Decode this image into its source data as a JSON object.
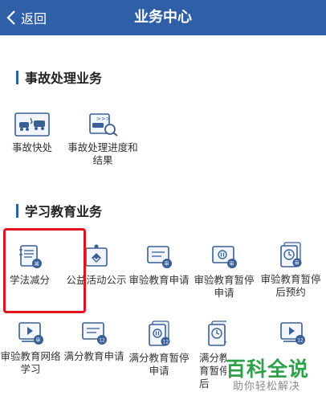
{
  "header": {
    "back_label": "返回",
    "title": "业务中心",
    "bg_color": "#2f5fa6"
  },
  "accident": {
    "title": "事故处理业务",
    "items": [
      {
        "label": "事故快处",
        "icon": "accident-quick-icon"
      },
      {
        "label": "事故处理进度和结果",
        "icon": "accident-progress-icon"
      }
    ]
  },
  "study": {
    "title": "学习教育业务",
    "items": [
      {
        "label": "学法减分",
        "icon": "study-law-icon"
      },
      {
        "label": "公益活动公示",
        "icon": "public-welfare-icon"
      },
      {
        "label": "审验教育申请",
        "icon": "review-education-apply-icon"
      },
      {
        "label": "审验教育暂停申请",
        "icon": "review-education-pause-icon"
      },
      {
        "label": "审验教育暂停后预约",
        "icon": "review-education-appointment-icon"
      },
      {
        "label": "审验教育网络学习",
        "icon": "review-education-online-icon"
      },
      {
        "label": "满分教育申请",
        "icon": "full-score-apply-icon"
      },
      {
        "label": "满分教育暂停申请",
        "icon": "full-score-pause-icon"
      },
      {
        "label": "满分教育暂停后",
        "icon": "full-score-after-icon"
      },
      {
        "label": "",
        "icon": "full-score-video-icon"
      }
    ]
  },
  "watermark": {
    "main": "百科全说",
    "sub": "助你轻松解决"
  }
}
